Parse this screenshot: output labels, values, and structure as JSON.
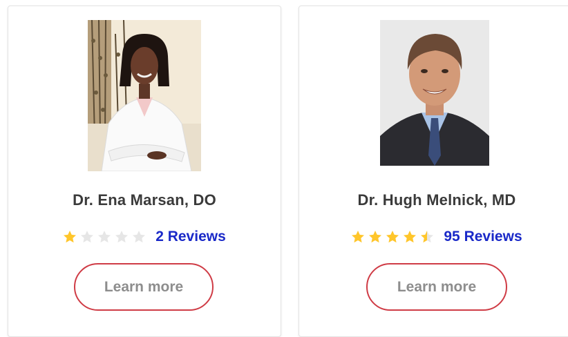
{
  "colors": {
    "star_filled": "#ffc62b",
    "star_empty": "#e6e6e6",
    "link": "#1a29c8",
    "button_border": "#cf3b45",
    "button_text": "#8d8d8d",
    "name_text": "#3a3a3a"
  },
  "doctors": [
    {
      "name": "Dr. Ena Marsan, DO",
      "rating": 1,
      "max_rating": 5,
      "reviews_label": "2 Reviews",
      "button_label": "Learn more",
      "photo_icon": "doctor-photo-icon"
    },
    {
      "name": "Dr. Hugh Melnick, MD",
      "rating": 4.5,
      "max_rating": 5,
      "reviews_label": "95 Reviews",
      "button_label": "Learn more",
      "photo_icon": "doctor-photo-icon"
    }
  ]
}
